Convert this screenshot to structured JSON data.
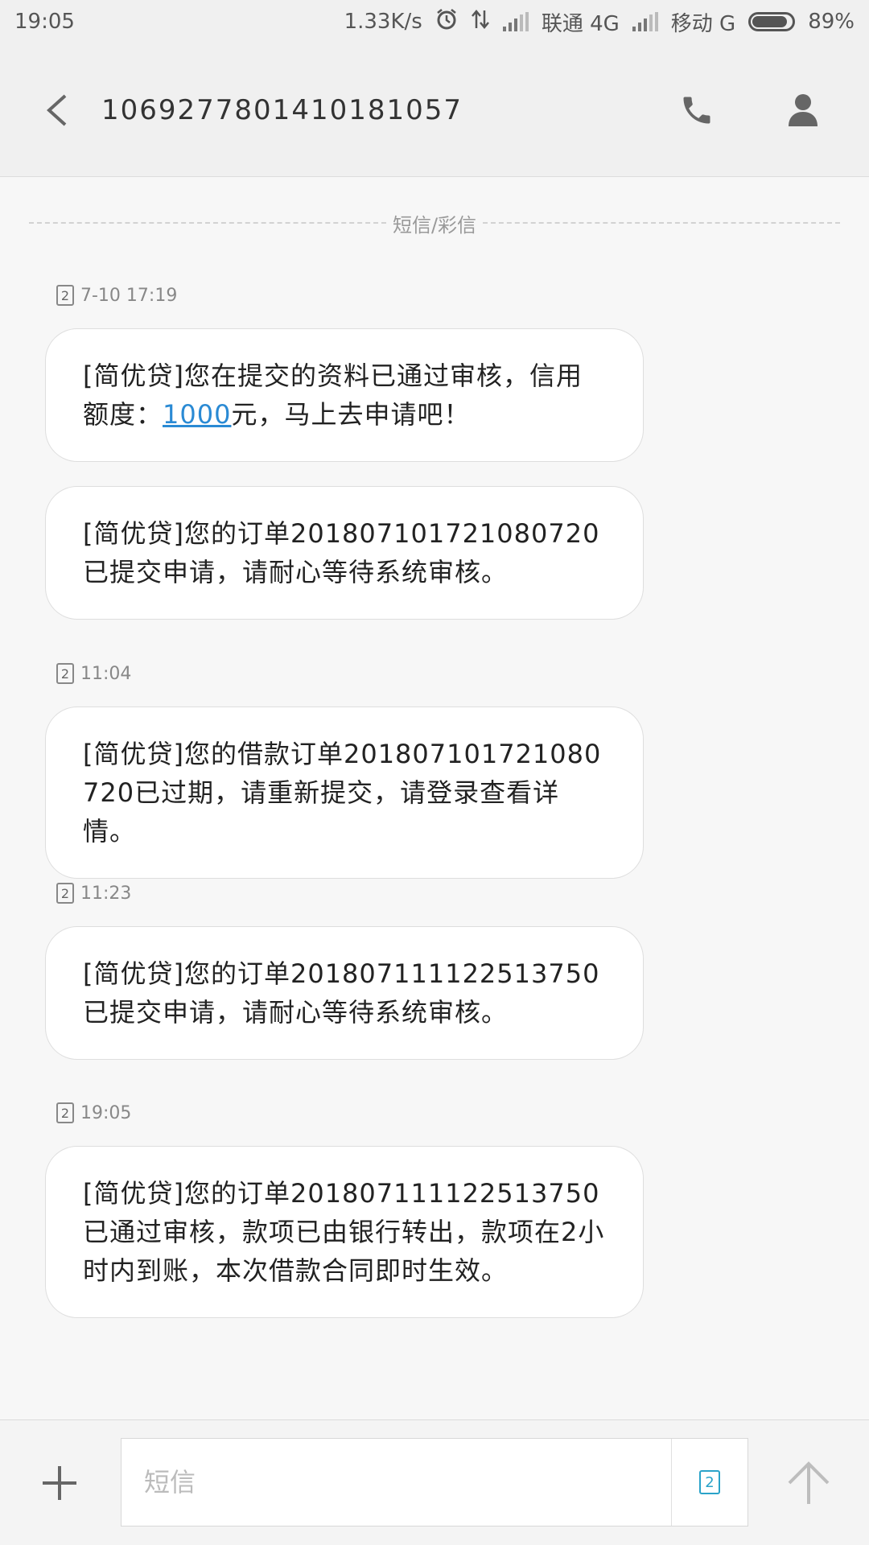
{
  "status_bar": {
    "time": "19:05",
    "net_speed": "1.33K/s",
    "carrier1": "联通 4G",
    "carrier2": "移动 G",
    "battery": "89%",
    "battery_level": 0.89
  },
  "header": {
    "contact_number": "1069277801410181057"
  },
  "divider_label": "短信/彩信",
  "messages": [
    {
      "sim": "2",
      "timestamp": "7-10 17:19",
      "bubbles": [
        {
          "pre": "[简优贷]您在提交的资料已通过审核，信用额度：",
          "link": "1000",
          "post": "元，马上去申请吧！"
        },
        {
          "text": "[简优贷]您的订单201807101721080720已提交申请，请耐心等待系统审核。"
        }
      ]
    },
    {
      "sim": "2",
      "timestamp": "11:04",
      "bubbles": [
        {
          "text": "[简优贷]您的借款订单201807101721080720已过期，请重新提交，请登录查看详情。"
        }
      ]
    },
    {
      "sim": "2",
      "timestamp": "11:23",
      "bubbles": [
        {
          "text": "[简优贷]您的订单201807111122513750已提交申请，请耐心等待系统审核。"
        }
      ]
    },
    {
      "sim": "2",
      "timestamp": "19:05",
      "bubbles": [
        {
          "text": "[简优贷]您的订单201807111122513750已通过审核，款项已由银行转出，款项在2小时内到账，本次借款合同即时生效。"
        }
      ]
    }
  ],
  "composer": {
    "placeholder": "短信",
    "sim": "2"
  },
  "icons": {
    "back": "chevron-left-icon",
    "call": "phone-icon",
    "contact": "person-icon",
    "add": "plus-icon",
    "send": "arrow-up-icon",
    "alarm": "alarm-icon"
  }
}
